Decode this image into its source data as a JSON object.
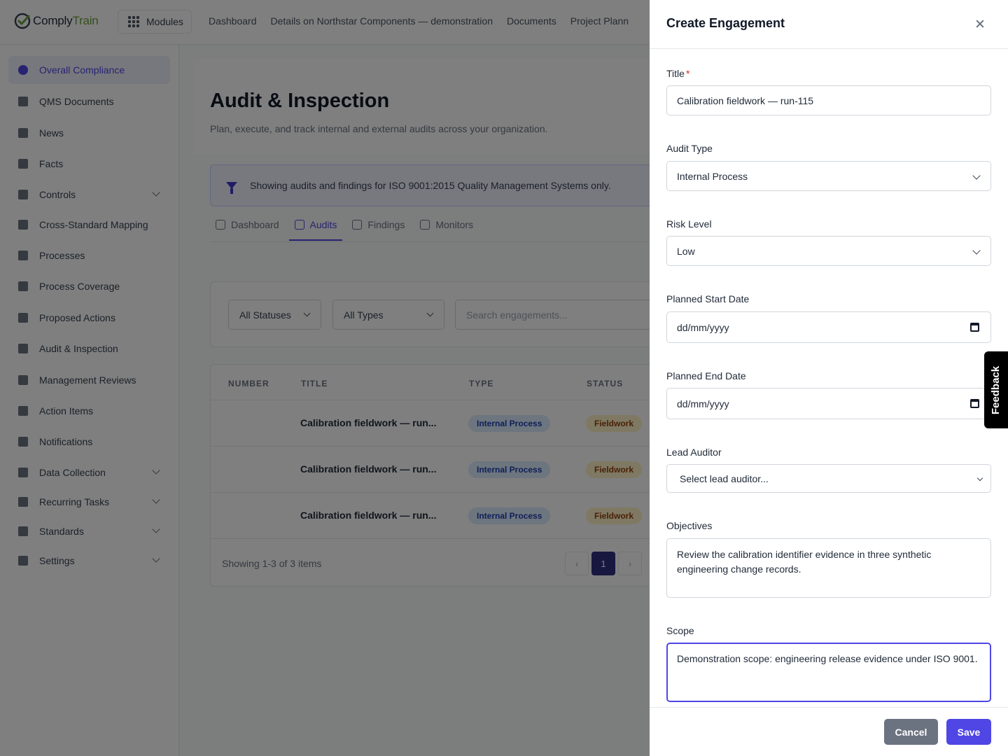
{
  "brand": {
    "name_prefix": "Comply",
    "name_suffix": "Train",
    "logo_color": "#6b9e3c"
  },
  "topbar": {
    "modules_label": "Modules",
    "nav": [
      "Dashboard",
      "Details on Northstar Components — demonstration",
      "Documents",
      "Project Plann"
    ]
  },
  "sidebar": {
    "items": [
      {
        "label": "Overall Compliance",
        "icon": "pie-chart-icon",
        "active": true
      },
      {
        "label": "QMS Documents",
        "icon": "document-icon"
      },
      {
        "label": "News",
        "icon": "megaphone-icon"
      },
      {
        "label": "Facts",
        "icon": "lightbulb-icon"
      },
      {
        "label": "Controls",
        "icon": "shield-icon",
        "expandable": true
      },
      {
        "label": "Cross-Standard Mapping",
        "icon": "table-icon"
      },
      {
        "label": "Processes",
        "icon": "flow-icon"
      },
      {
        "label": "Process Coverage",
        "icon": "columns-icon"
      },
      {
        "label": "Proposed Actions",
        "icon": "list-x-icon"
      },
      {
        "label": "Audit & Inspection",
        "icon": "clipboard-icon"
      },
      {
        "label": "Management Reviews",
        "icon": "chart-icon"
      },
      {
        "label": "Action Items",
        "icon": "checklist-icon"
      },
      {
        "label": "Notifications",
        "icon": "bell-icon"
      },
      {
        "label": "Data Collection",
        "icon": "clipboard-list-icon",
        "expandable": true
      },
      {
        "label": "Recurring Tasks",
        "icon": "repeat-icon",
        "expandable": true
      },
      {
        "label": "Standards",
        "icon": "bookmark-icon",
        "expandable": true
      },
      {
        "label": "Settings",
        "icon": "gear-icon",
        "expandable": true
      }
    ]
  },
  "page": {
    "title": "Audit & Inspection",
    "subtitle": "Plan, execute, and track internal and external audits across your organization.",
    "banner": "Showing audits and findings for ISO 9001:2015 Quality Management Systems only.",
    "tabs": [
      {
        "label": "Dashboard",
        "icon": "line-chart-icon"
      },
      {
        "label": "Audits",
        "icon": "clipboard-check-icon",
        "active": true
      },
      {
        "label": "Findings",
        "icon": "warning-icon"
      },
      {
        "label": "Monitors",
        "icon": "radar-icon"
      }
    ],
    "filters": {
      "status": "All Statuses",
      "type": "All Types",
      "search_placeholder": "Search engagements..."
    },
    "table": {
      "columns": [
        "NUMBER",
        "TITLE",
        "TYPE",
        "STATUS"
      ],
      "rows": [
        {
          "number": "",
          "title": "Calibration fieldwork — run...",
          "type": "Internal Process",
          "status": "Fieldwork"
        },
        {
          "number": "",
          "title": "Calibration fieldwork — run...",
          "type": "Internal Process",
          "status": "Fieldwork"
        },
        {
          "number": "",
          "title": "Calibration fieldwork — run...",
          "type": "Internal Process",
          "status": "Fieldwork"
        }
      ],
      "footer": "Showing 1-3 of 3 items",
      "current_page": "1"
    }
  },
  "panel": {
    "title": "Create Engagement",
    "fields": {
      "title_label": "Title",
      "title_required": "*",
      "title_value": "Calibration fieldwork — run-115",
      "audit_type_label": "Audit Type",
      "audit_type_value": "Internal Process",
      "risk_level_label": "Risk Level",
      "risk_level_value": "Low",
      "start_date_label": "Planned Start Date",
      "start_date_value": "dd/mm/yyyy",
      "end_date_label": "Planned End Date",
      "end_date_value": "dd/mm/yyyy",
      "lead_auditor_label": "Lead Auditor",
      "lead_auditor_value": "Select lead auditor...",
      "objectives_label": "Objectives",
      "objectives_value": "Review the calibration identifier evidence in three synthetic engineering change records.",
      "scope_label": "Scope",
      "scope_value": "Demonstration scope: engineering release evidence under ISO 9001."
    },
    "cancel_label": "Cancel",
    "save_label": "Save"
  },
  "feedback_label": "Feedback",
  "colors": {
    "accent": "#4f46e5",
    "overlay": "rgba(0,0,0,0.5)",
    "cancel": "#6b7280"
  }
}
